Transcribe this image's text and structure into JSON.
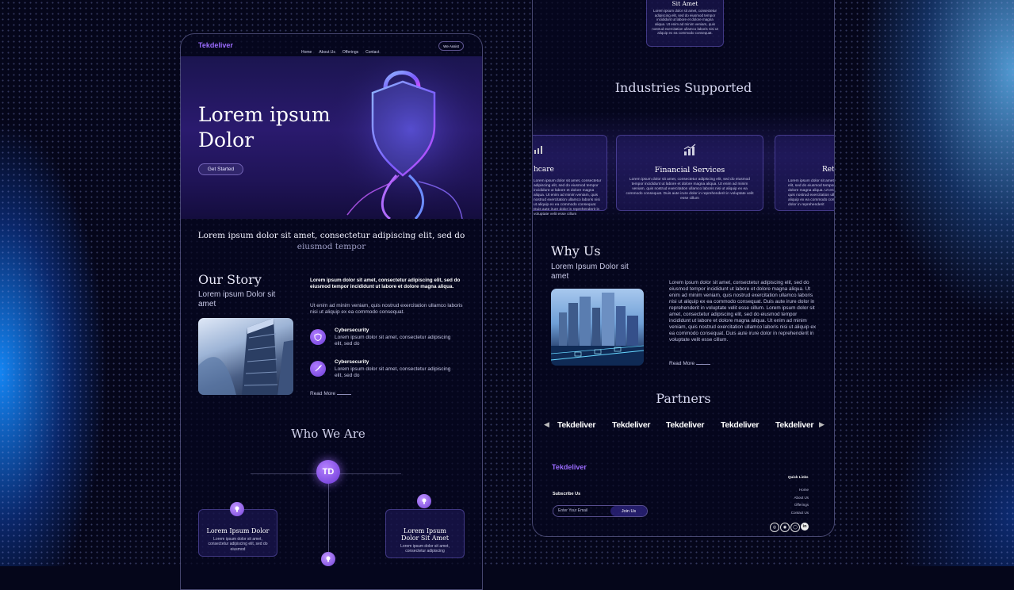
{
  "left": {
    "logo": "Tekdeliver",
    "nav": [
      "Home",
      "About Us",
      "Offerings",
      "Contact"
    ],
    "nav_button": "We Assist",
    "hero": {
      "title_line1": "Lorem ipsum",
      "title_line2": "Dolor",
      "cta": "Get Started"
    },
    "intro_line1": "Lorem ipsum dolor sit amet, consectetur adipiscing elit, sed do",
    "intro_line2": "eiusmod tempor",
    "story": {
      "title": "Our Story",
      "subtitle": "Lorem ipsum Dolor sit amet",
      "bold_text": "Lorem ipsum dolor sit amet, consectetur adipiscing elit, sed do eiusmod tempor incididunt ut labore et dolore magna aliqua.",
      "text": "Ut enim ad minim veniam, quis nostrud exercitation ullamco laboris nisi ut aliquip ex ea commodo consequat.",
      "features": [
        {
          "icon": "shield-check-icon",
          "title": "Cybersecurity",
          "text": "Lorem ipsum dolor sit amet, consectetur adipiscing elit, sed do"
        },
        {
          "icon": "rocket-icon",
          "title": "Cybersecurity",
          "text": "Lorem ipsum dolor sit amet, consectetur adipiscing elit, sed do"
        }
      ],
      "read_more": "Read More"
    },
    "who": {
      "title": "Who We Are",
      "center_badge": "TD",
      "cards": [
        {
          "title": "Lorem Ipsum Dolor",
          "text": "Lorem ipsum dolor sit amet, consectetur adipiscing elit, sed do eiusmod"
        },
        {
          "title": "Lorem Ipsum Dolor Sit Amet",
          "text": "Lorem ipsum dolor sit amet, consectetur adipiscing"
        }
      ]
    }
  },
  "right": {
    "top_card": {
      "title": "Sit Amet",
      "text": "Lorem ipsum dolor sit amet, consectetur adipiscing elit, sed do eiusmod tempor incididunt ut labore et dolore magna aliqua. Ut enim ad minim veniam, quis nostrud exercitation ullamco laboris nisi ut aliquip ex ea commodo consequat."
    },
    "industries": {
      "title": "Industries Supported",
      "cards": [
        {
          "title": "hcare",
          "text": "Lorem ipsum dolor sit amet, consectetur adipiscing elit, sed do eiusmod tempor incididunt ut labore et dolore magna aliqua. Ut enim ad minim veniam, quis nostrud exercitation ullamco laboris nisi ut aliquip ex ea commodo consequat. Duis aute irure dolor in reprehenderit in voluptate velit esse cillum"
        },
        {
          "title": "Financial Services",
          "text": "Lorem ipsum dolor sit amet, consectetur adipiscing elit, sed do eiusmod tempor incididunt ut labore et dolore magna aliqua. Ut enim ad minim veniam, quis nostrud exercitation ullamco laboris nisi ut aliquip ex ea commodo consequat. Duis aute irure dolor in reprehenderit in voluptate velit esse cillum"
        },
        {
          "title": "Ret",
          "text": "Lorem ipsum dolor sit amet, consectetur adipiscing elit, sed do eiusmod tempor incididunt ut labore et dolore magna aliqua. Ut enim ad minim veniam, quis nostrud exercitation ullamco laboris nisi ut aliquip ex ea commodo consequat. Duis aute irure dolor in reprehenderit"
        }
      ]
    },
    "why": {
      "title": "Why Us",
      "subtitle": "Lorem Ipsum Dolor sit amet",
      "text": "Lorem ipsum dolor sit amet, consectetur adipiscing elit, sed do eiusmod tempor incididunt ut labore et dolore magna aliqua. Ut enim ad minim veniam, quis nostrud exercitation ullamco laboris nisi ut aliquip ex ea commodo consequat. Duis aute irure dolor in reprehenderit in voluptate velit esse cillum. Lorem ipsum dolor sit amet, consectetur adipiscing elit, sed do eiusmod tempor incididunt ut labore et dolore magna aliqua. Ut enim ad minim veniam, quis nostrud exercitation ullamco laboris nisi ut aliquip ex ea commodo consequat. Duis aute irure dolor in reprehenderit in voluptate velit esse cillum.",
      "read_more": "Read More"
    },
    "partners": {
      "title": "Partners",
      "logos": [
        "Tekdeliver",
        "Tekdeliver",
        "Tekdeliver",
        "Tekdeliver",
        "Tekdeliver"
      ]
    },
    "footer": {
      "logo": "Tekdeliver",
      "subscribe_label": "Subscribe Us",
      "email_placeholder": "Enter Your Email",
      "join_button": "Join Us",
      "quick_links_title": "Quick Links",
      "quick_links": [
        "Home",
        "About Us",
        "Offerings",
        "Contact Us"
      ],
      "social": [
        "web-icon",
        "globe-icon",
        "instagram-icon",
        "linkedin-icon"
      ]
    }
  },
  "colors": {
    "accent": "#8b5cf6",
    "logo": "#9b6cff",
    "background": "#05061a"
  }
}
